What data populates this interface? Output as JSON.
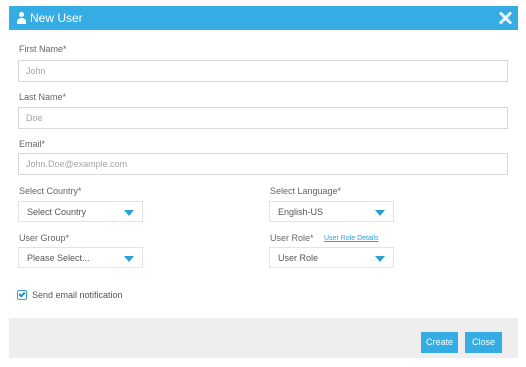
{
  "dialog": {
    "title": "New User",
    "icon": "user-icon",
    "close_icon": "close-icon",
    "title_color": "#35ace3"
  },
  "form": {
    "first_name": {
      "label": "First Name*",
      "placeholder": "John",
      "value": ""
    },
    "last_name": {
      "label": "Last Name*",
      "placeholder": "Doe",
      "value": ""
    },
    "email": {
      "label": "Email*",
      "placeholder": "John.Doe@example.com",
      "value": ""
    },
    "country": {
      "label": "Select Country*",
      "selected": "Select Country"
    },
    "language": {
      "label": "Select Language*",
      "selected": "English-US"
    },
    "user_group": {
      "label": "User Group*",
      "selected": "Please Select..."
    },
    "user_role": {
      "label": "User Role*",
      "selected": "User Role",
      "details_link": "User Role Details"
    },
    "notification": {
      "label": "Send email notification",
      "checked": true
    }
  },
  "footer": {
    "create_label": "Create",
    "close_label": "Close",
    "button_color": "#35ace3"
  }
}
